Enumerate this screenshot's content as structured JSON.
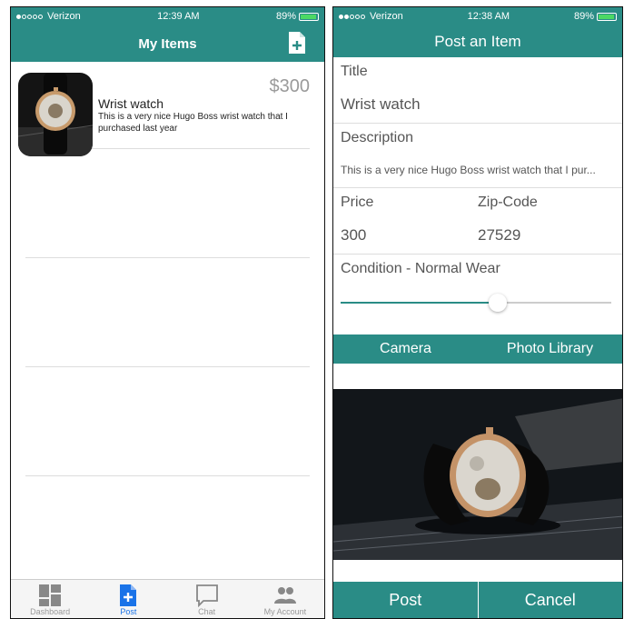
{
  "colors": {
    "teal": "#2a8c86",
    "active_blue": "#1a73e8",
    "price_gray": "#9a9a9a"
  },
  "left": {
    "status": {
      "carrier": "Verizon",
      "time": "12:39 AM",
      "battery": "89%"
    },
    "nav": {
      "title": "My Items",
      "add_icon": "add-document-icon"
    },
    "items": [
      {
        "title": "Wrist watch",
        "description": "This is a very nice Hugo Boss wrist watch that I purchased last year",
        "price": "$300"
      }
    ],
    "tabs": [
      {
        "label": "Dashboard",
        "icon": "dashboard-icon"
      },
      {
        "label": "Post",
        "icon": "add-document-icon"
      },
      {
        "label": "Chat",
        "icon": "chat-icon"
      },
      {
        "label": "My Account",
        "icon": "people-icon"
      }
    ]
  },
  "right": {
    "status": {
      "carrier": "Verizon",
      "time": "12:38 AM",
      "battery": "89%"
    },
    "nav": {
      "title": "Post an Item"
    },
    "form": {
      "title_label": "Title",
      "title_value": "Wrist watch",
      "description_label": "Description",
      "description_value": "This is a very nice Hugo Boss wrist watch that I pur...",
      "price_label": "Price",
      "price_value": "300",
      "zip_label": "Zip-Code",
      "zip_value": "27529",
      "condition_label": "Condition -",
      "condition_value": "Normal Wear",
      "condition_slider": 0.58
    },
    "photo_buttons": {
      "camera": "Camera",
      "library": "Photo Library"
    },
    "actions": {
      "post": "Post",
      "cancel": "Cancel"
    }
  }
}
